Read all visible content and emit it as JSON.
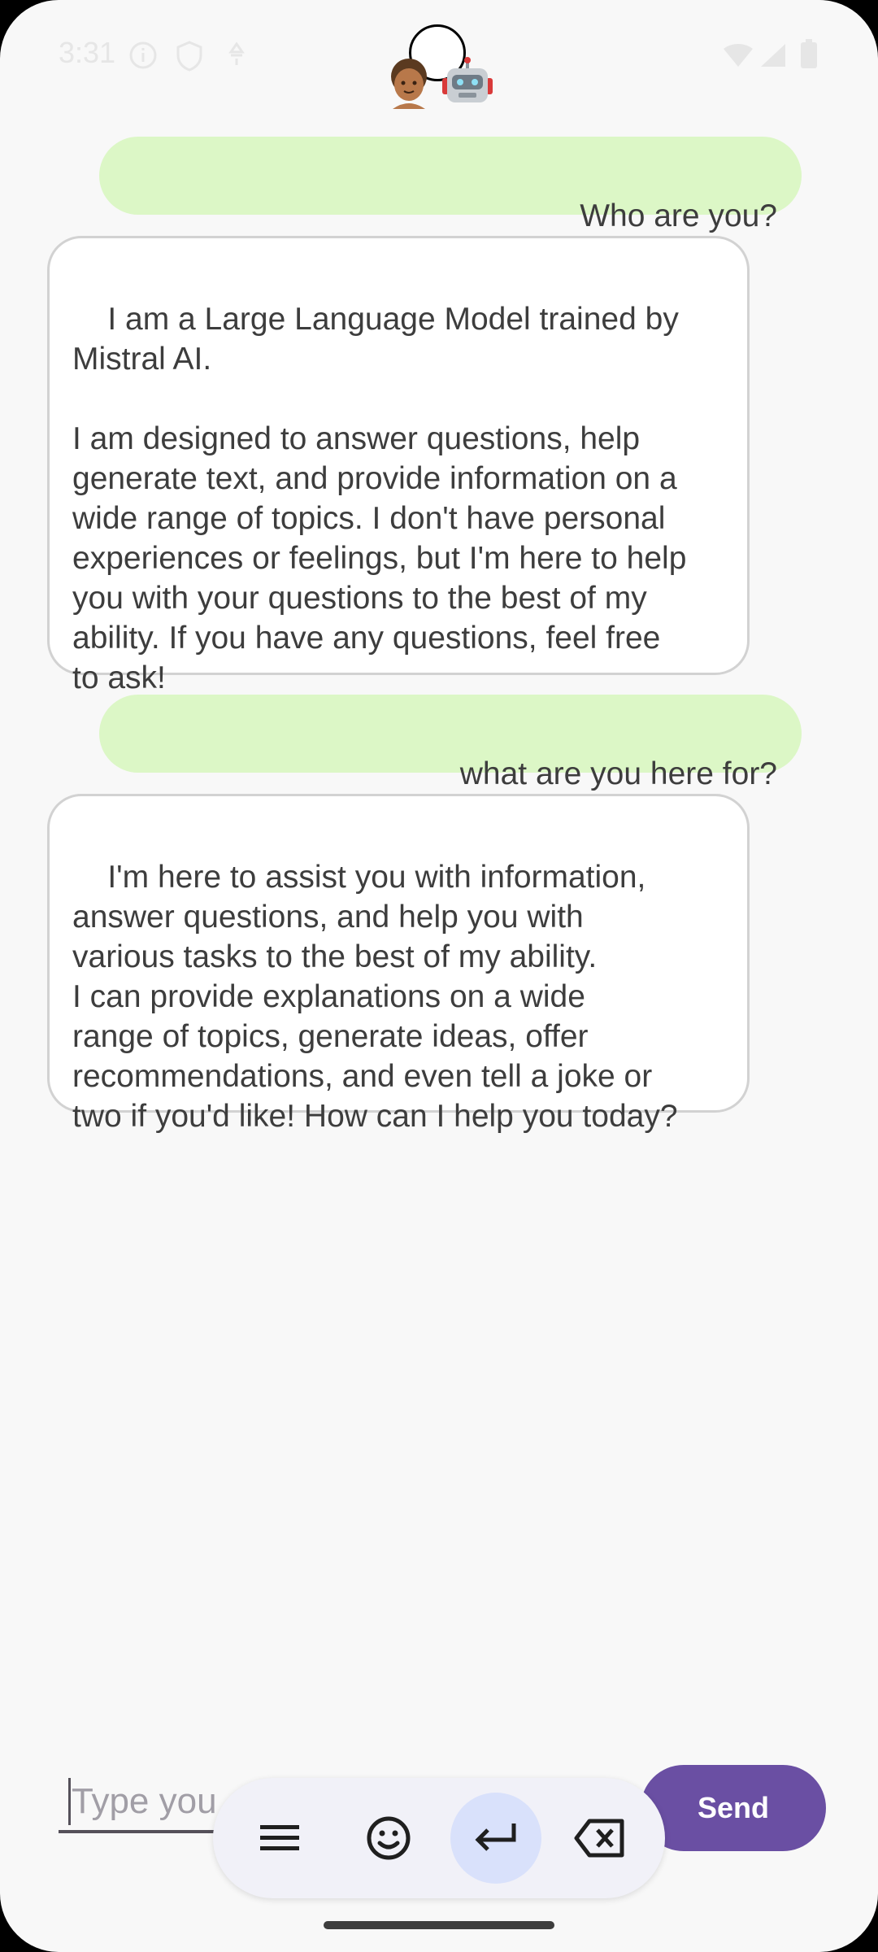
{
  "status_bar": {
    "time": "3:31"
  },
  "messages": [
    {
      "role": "user",
      "text": "Who are you?"
    },
    {
      "role": "assistant",
      "text": "I am a Large Language Model trained by\nMistral AI.\n\nI am designed to answer questions, help\ngenerate text, and provide information on a\nwide range of topics. I don't have personal\nexperiences or feelings, but I'm here to help\nyou with your questions to the best of my\nability. If you have any questions, feel free\nto ask!"
    },
    {
      "role": "user",
      "text": "what are you here for?"
    },
    {
      "role": "assistant",
      "text": "I'm here to assist you with information,\nanswer questions, and help you with\nvarious tasks to the best of my ability.\nI can provide explanations on a wide\nrange of topics, generate ideas, offer\nrecommendations, and even tell a joke or\ntwo if you'd like! How can I help you today?"
    }
  ],
  "composer": {
    "placeholder": "Type you",
    "send_label": "Send"
  },
  "toolbar": {
    "items": [
      {
        "icon": "menu-icon"
      },
      {
        "icon": "emoji-icon"
      },
      {
        "icon": "enter-icon",
        "active": true
      },
      {
        "icon": "backspace-icon"
      }
    ]
  },
  "colors": {
    "user_bubble": "#dcf7c6",
    "assistant_bubble": "#ffffff",
    "send_button": "#6a4fa3",
    "toolbar_active": "#d9e1fb"
  }
}
